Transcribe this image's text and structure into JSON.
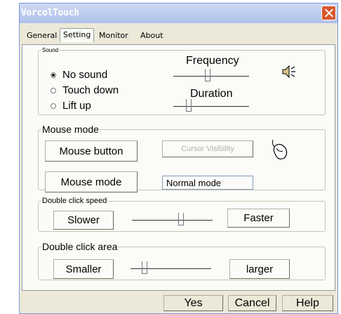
{
  "window": {
    "title": "VorcolTouch"
  },
  "tabs": [
    "General",
    "Setting",
    "Monitor",
    "About"
  ],
  "sound": {
    "legend": "Sound",
    "options": [
      "No sound",
      "Touch down",
      "Lift up"
    ],
    "selected": "No sound",
    "frequency_label": "Frequency",
    "frequency_value": 0.45,
    "duration_label": "Duration",
    "duration_value": 0.18,
    "icon": "speaker-icon"
  },
  "mouse_mode": {
    "legend": "Mouse mode",
    "mouse_button_label": "Mouse button",
    "cursor_visibility_label": "Cursor Visibility",
    "mouse_mode_button_label": "Mouse mode",
    "mode_value": "Normal mode",
    "icon": "mouse-icon"
  },
  "double_click_speed": {
    "legend": "Double click speed",
    "slower_label": "Slower",
    "faster_label": "Faster",
    "value": 0.62
  },
  "double_click_area": {
    "legend": "Double click area",
    "smaller_label": "Smaller",
    "larger_label": "larger",
    "value": 0.15
  },
  "footer": {
    "yes": "Yes",
    "cancel": "Cancel",
    "help": "Help"
  },
  "colors": {
    "title_bar": "#b9c9ee",
    "close_button": "#d9572e",
    "dialog_bg": "#ece9d8",
    "panel_bg": "#fbfbf8"
  }
}
